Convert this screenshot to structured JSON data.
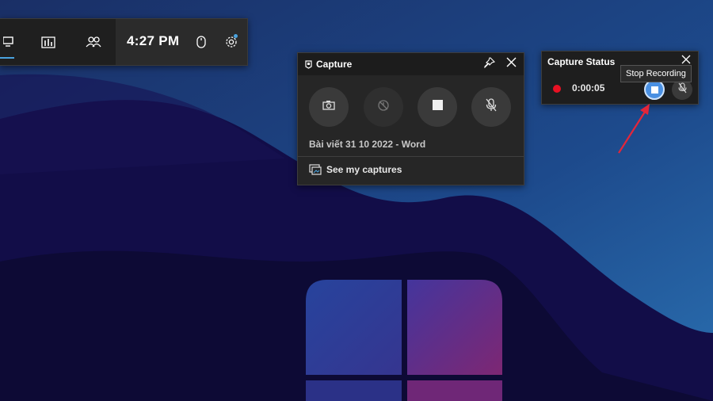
{
  "topbar": {
    "clock": "4:27 PM",
    "icons": [
      "widget-menu-icon",
      "performance-icon",
      "social-icon",
      "mouse-icon",
      "settings-icon"
    ],
    "accent": "#4aa3df"
  },
  "capture": {
    "title": "Capture",
    "source": "Bài viết 31 10 2022 - Word",
    "see_captures": "See my captures",
    "buttons": [
      "screenshot",
      "record-last-30s",
      "stop-recording",
      "mic-off"
    ]
  },
  "capture_status": {
    "title": "Capture Status",
    "elapsed": "0:00:05",
    "tooltip": "Stop Recording",
    "record_color": "#e81123",
    "stop_button_color": "#4a90e2"
  },
  "annotation": {
    "arrow_color": "#e3263a"
  }
}
